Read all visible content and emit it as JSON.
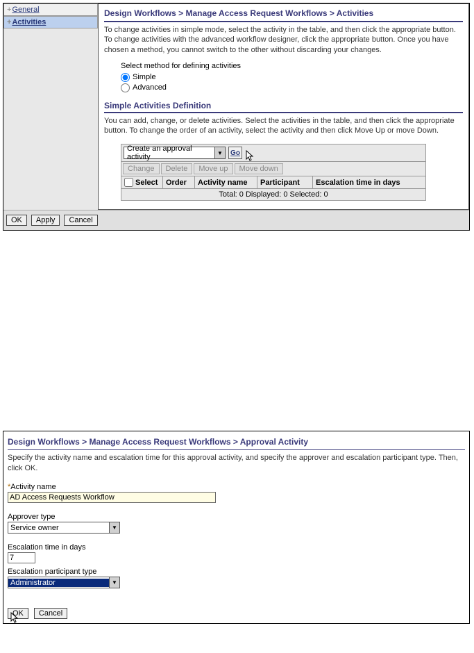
{
  "panel1": {
    "sidebar": {
      "items": [
        {
          "label": "General",
          "active": false
        },
        {
          "label": "Activities",
          "active": true
        }
      ],
      "plus": "+"
    },
    "breadcrumb": "Design Workflows > Manage Access Request Workflows > Activities",
    "intro": "To change activities in simple mode, select the activity in the table, and then click the appropriate button. To change activities with the advanced workflow designer, click the appropriate button. Once you have chosen a method, you cannot switch to the other without discarding your changes.",
    "method_label": "Select method for defining activities",
    "radios": {
      "simple": "Simple",
      "advanced": "Advanced"
    },
    "subheading": "Simple Activities Definition",
    "sub_intro": "You can add, change, or delete activities. Select the activities in the table, and then click the appropriate button. To change the order of an activity, select the activity and then click Move Up or move Down.",
    "combo": "Create an approval activity",
    "go": "Go",
    "tbuttons": {
      "change": "Change",
      "delete": "Delete",
      "moveup": "Move up",
      "movedown": "Move down"
    },
    "columns": {
      "select": "Select",
      "order": "Order",
      "activity": "Activity name",
      "participant": "Participant",
      "escalation": "Escalation time in days"
    },
    "footer": "Total: 0  Displayed: 0  Selected: 0",
    "buttons": {
      "ok": "OK",
      "apply": "Apply",
      "cancel": "Cancel"
    }
  },
  "panel2": {
    "breadcrumb": "Design Workflows > Manage Access Request Workflows > Approval Activity",
    "intro": "Specify the activity name and escalation time for this approval activity, and specify the approver and escalation participant type. Then, click OK.",
    "activity_name_label": "Activity name",
    "star": "*",
    "activity_name_value": "AD Access Requests Workflow",
    "approver_label": "Approver type",
    "approver_value": "Service owner",
    "escalation_label": "Escalation time in days",
    "escalation_value": "7",
    "ept_label": "Escalation participant type",
    "ept_value": "Administrator",
    "buttons": {
      "ok": "OK",
      "cancel": "Cancel"
    }
  }
}
